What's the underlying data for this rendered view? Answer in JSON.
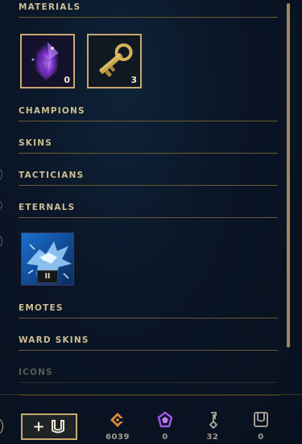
{
  "sections": {
    "materials": "MATERIALS",
    "champions": "CHAMPIONS",
    "skins": "SKINS",
    "tacticians": "TACTICIANS",
    "eternals": "ETERNALS",
    "emotes": "EMOTES",
    "ward_skins": "WARD SKINS",
    "icons": "ICONS"
  },
  "materials": [
    {
      "icon": "mythic-essence-crystal-icon",
      "count": "0"
    },
    {
      "icon": "hextech-key-fragment-icon",
      "count": "3"
    }
  ],
  "eternals": [
    {
      "icon": "eternal-dragon-icon",
      "tier": "II"
    }
  ],
  "currencies": [
    {
      "icon": "blue-essence-icon",
      "value": "6039",
      "color": "#f0a050"
    },
    {
      "icon": "mythic-essence-icon",
      "value": "0",
      "color": "#b070f0"
    },
    {
      "icon": "key-fragment-icon",
      "value": "32",
      "color": "#a09b8c"
    },
    {
      "icon": "chest-icon",
      "value": "0",
      "color": "#a09b8c"
    }
  ],
  "colors": {
    "gold": "#c8aa6e",
    "background": "#0a1428"
  }
}
